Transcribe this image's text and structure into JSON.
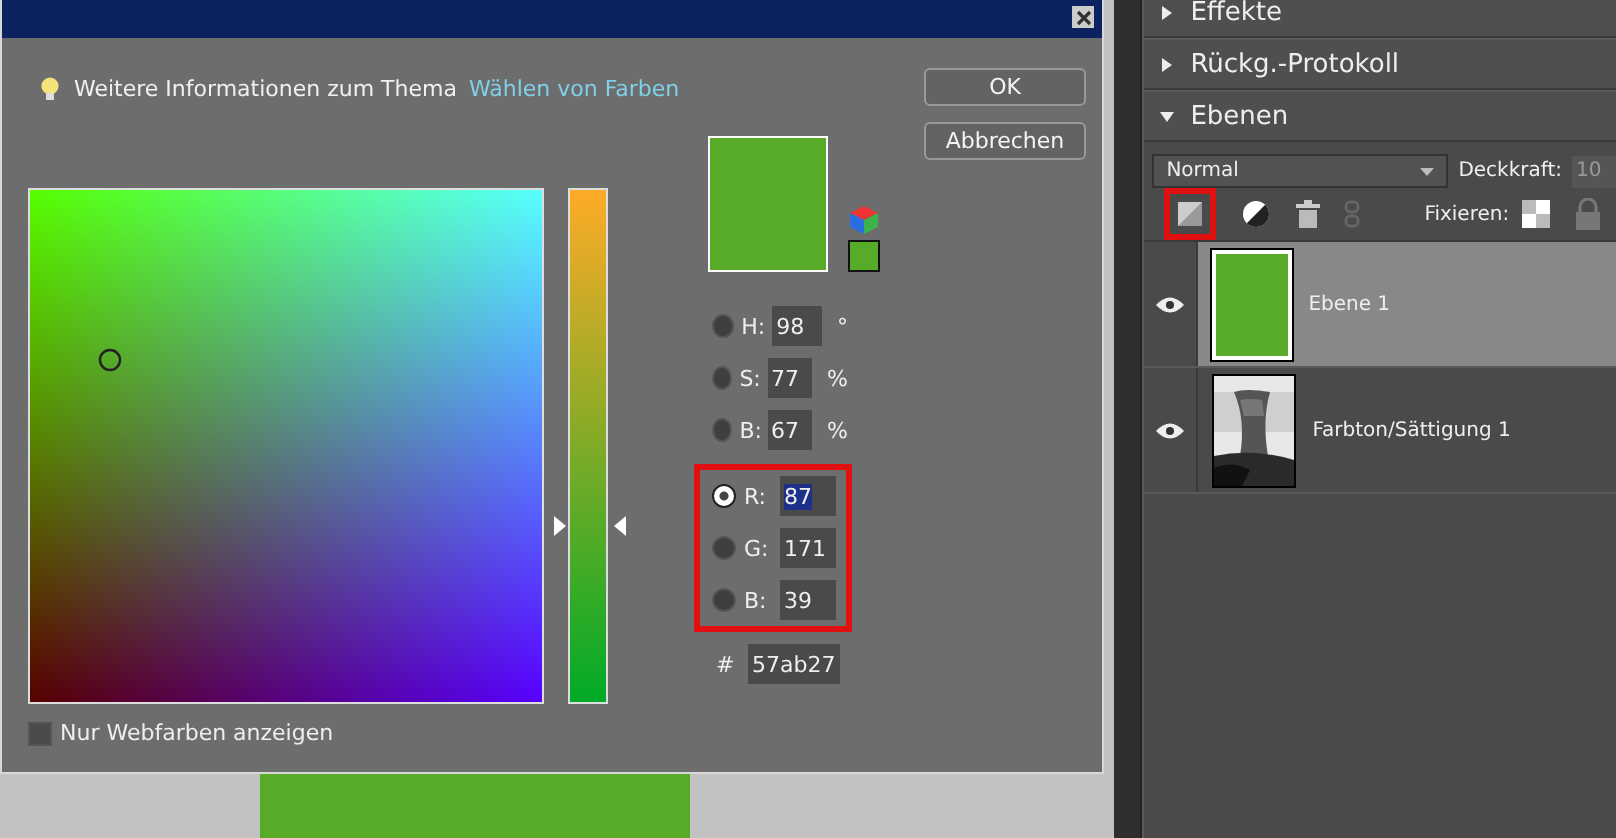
{
  "dialog": {
    "info_text": "Weitere Informationen zum Thema",
    "info_link": "Wählen von Farben",
    "buttons": [
      {
        "label": "OK"
      },
      {
        "label": "Abbrechen"
      }
    ],
    "hue_slider": {
      "level": 0.34
    },
    "field_groups": [
      {
        "fields": [
          {
            "label": "H:",
            "value": "98",
            "unit": "°",
            "selected": false,
            "text_selected": false
          },
          {
            "label": "S:",
            "value": "77",
            "unit": "%",
            "selected": false,
            "text_selected": false
          },
          {
            "label": "B:",
            "value": "67",
            "unit": "%",
            "selected": false,
            "text_selected": false
          }
        ]
      },
      {
        "highlighted": true,
        "fields": [
          {
            "label": "R:",
            "value": "87",
            "selected": true,
            "text_selected": true
          },
          {
            "label": "G:",
            "value": "171",
            "selected": false,
            "text_selected": false
          },
          {
            "label": "B:",
            "value": "39",
            "selected": false,
            "text_selected": false
          }
        ]
      }
    ],
    "hex_label": "#",
    "hex_value": "57ab27",
    "web_colors": {
      "label": "Nur Webfarben anzeigen",
      "checked": false
    }
  },
  "panel": {
    "sections": [
      {
        "title": "Effekte",
        "expanded": false
      },
      {
        "title": "Rückg.-Protokoll",
        "expanded": false
      },
      {
        "title": "Ebenen",
        "expanded": true
      }
    ],
    "blend_mode": "Normal",
    "opacity_label": "Deckkraft:",
    "opacity_value": "10",
    "tools": [
      {
        "kind": "new-layer",
        "highlighted": true
      },
      {
        "kind": "adjustment"
      },
      {
        "kind": "trash"
      },
      {
        "kind": "link"
      }
    ],
    "lock_label": "Fixieren:",
    "layers": [
      {
        "name": "Ebene 1",
        "kind": "fill",
        "selected": true,
        "visible": true
      },
      {
        "name": "Farbton/Sättigung 1",
        "kind": "picture",
        "selected": false,
        "visible": true
      }
    ]
  }
}
